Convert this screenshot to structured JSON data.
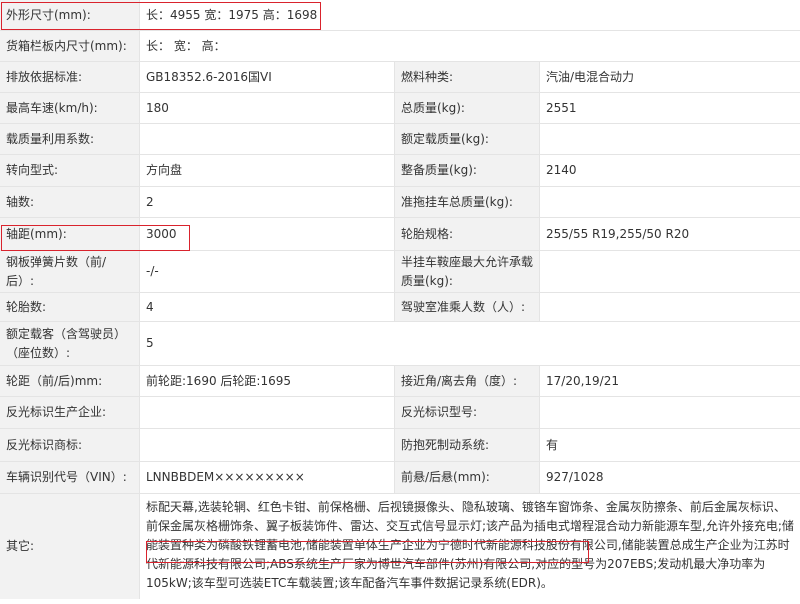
{
  "rows": [
    {
      "label": "外形尺寸(mm):",
      "value": "长：4955 宽：1975 高：1698",
      "full": true
    },
    {
      "label": "货箱栏板内尺寸(mm):",
      "value": "长： 宽： 高：",
      "full": true
    },
    {
      "label": "排放依据标准:",
      "value": "GB18352.6-2016国VI",
      "label2": "燃料种类:",
      "value2": "汽油/电混合动力"
    },
    {
      "label": "最高车速(km/h):",
      "value": "180",
      "label2": "总质量(kg):",
      "value2": "2551"
    },
    {
      "label": "载质量利用系数:",
      "value": "",
      "label2": "额定载质量(kg):",
      "value2": ""
    },
    {
      "label": "转向型式:",
      "value": "方向盘",
      "label2": "整备质量(kg):",
      "value2": "2140"
    },
    {
      "label": "轴数:",
      "value": "2",
      "label2": "准拖挂车总质量(kg):",
      "value2": ""
    },
    {
      "label": "轴距(mm):",
      "value": "3000",
      "label2": "轮胎规格:",
      "value2": "255/55 R19,255/50 R20"
    },
    {
      "label": "钢板弹簧片数（前/后）:",
      "value": "-/-",
      "label2": "半挂车鞍座最大允许承载质量(kg):",
      "value2": ""
    },
    {
      "label": "轮胎数:",
      "value": "4",
      "label2": "驾驶室准乘人数（人）:",
      "value2": ""
    },
    {
      "label": "额定载客（含驾驶员）（座位数）:",
      "value": "5",
      "full": true
    },
    {
      "label": "轮距（前/后)mm:",
      "value": "前轮距:1690 后轮距:1695",
      "label2": "接近角/离去角（度）:",
      "value2": "17/20,19/21"
    },
    {
      "label": "反光标识生产企业:",
      "value": "",
      "label2": "反光标识型号:",
      "value2": ""
    },
    {
      "label": "反光标识商标:",
      "value": "",
      "label2": "防抱死制动系统:",
      "value2": "有"
    },
    {
      "label": "车辆识别代号（VIN）:",
      "value": "LNNBBDEM×××××××××",
      "label2": "前悬/后悬(mm):",
      "value2": "927/1028"
    }
  ],
  "other": {
    "label": "其它:",
    "value": "标配天幕,选装轮辋、红色卡钳、前保格栅、后视镜摄像头、隐私玻璃、镀铬车窗饰条、金属灰防擦条、前后金属灰标识、前保金属灰格栅饰条、翼子板装饰件、雷达、交互式信号显示灯;该产品为插电式增程混合动力新能源车型,允许外接充电;储能装置种类为磷酸铁锂蓄电池,储能装置单体生产企业为宁德时代新能源科技股份有限公司,储能装置总成生产企业为江苏时代新能源科技有限公司;ABS系统生产厂家为博世汽车部件(苏州)有限公司,对应的型号为207EBS;发动机最大净功率为105kW;该车型可选装ETC车载装置;该车配备汽车事件数据记录系统(EDR)。"
  },
  "highlight_color": "#d9232d"
}
